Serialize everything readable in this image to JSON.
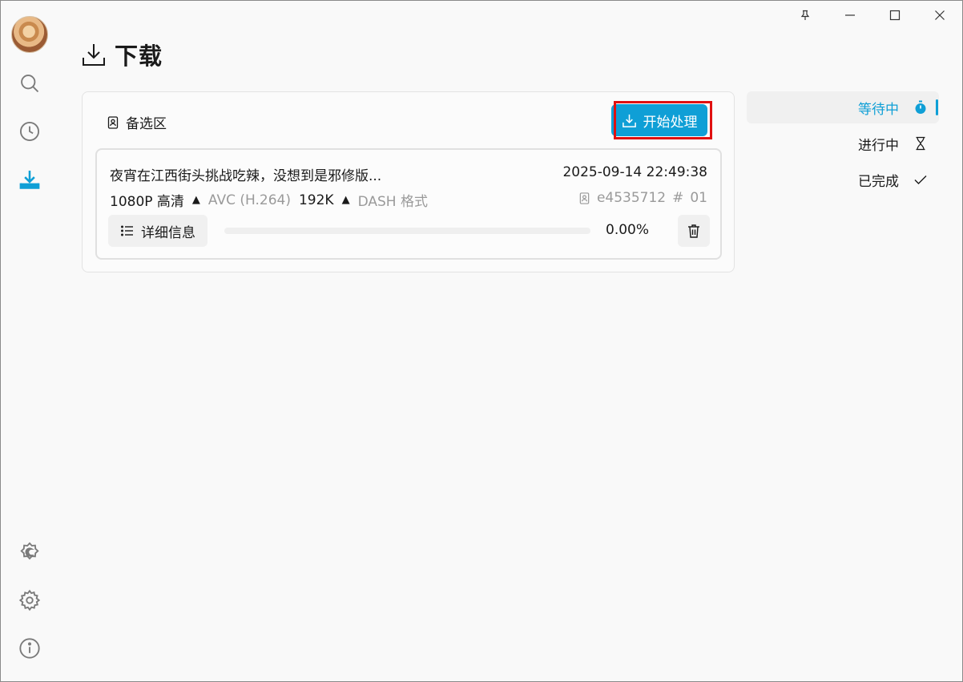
{
  "window": {
    "controls": [
      "pin",
      "minimize",
      "maximize",
      "close"
    ]
  },
  "nav": {
    "items": [
      {
        "name": "search",
        "icon": "search-icon"
      },
      {
        "name": "history",
        "icon": "clock-icon"
      },
      {
        "name": "download",
        "icon": "download-icon",
        "active": true
      }
    ],
    "bottom": [
      {
        "name": "theme",
        "icon": "theme-icon"
      },
      {
        "name": "settings",
        "icon": "gear-icon"
      },
      {
        "name": "about",
        "icon": "info-icon"
      }
    ]
  },
  "page": {
    "title": "下载"
  },
  "panel": {
    "label": "备选区",
    "start_label": "开始处理"
  },
  "task": {
    "title": "夜宵在江西街头挑战吃辣，没想到是邪修版...",
    "timestamp": "2025-09-14 22:49:38",
    "resolution": "1080P 高清",
    "codec": "AVC (H.264)",
    "audio": "192K",
    "format": "DASH 格式",
    "id": "e4535712",
    "index_symbol": "#",
    "index": "01",
    "detail_label": "详细信息",
    "progress": 0.0,
    "progress_text": "0.00%"
  },
  "status_tabs": [
    {
      "label": "等待中",
      "icon": "stopwatch-icon",
      "active": true
    },
    {
      "label": "进行中",
      "icon": "hourglass-icon"
    },
    {
      "label": "已完成",
      "icon": "check-icon"
    }
  ],
  "colors": {
    "accent": "#0f9fd6",
    "highlight": "#e01010"
  }
}
